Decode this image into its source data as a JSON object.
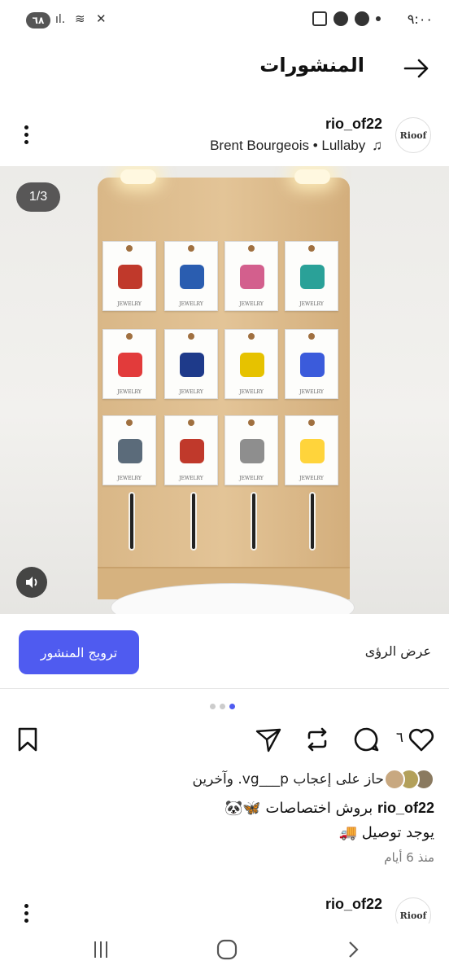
{
  "status_bar": {
    "battery": "٦٨",
    "time": "٩:٠٠"
  },
  "header": {
    "title": "المنشورات",
    "back_icon": "arrow-right-icon"
  },
  "post": {
    "avatar_text": "Rioof",
    "username": "rio_of22",
    "music": "Brent Bourgeois • Lullaby",
    "media": {
      "counter": "1/3",
      "card_label": "JEWELRY",
      "pin_colors": [
        "#c0392b",
        "#2a5db0",
        "#d35f8d",
        "#2aa198",
        "#e23b3b",
        "#1e3a8a",
        "#e6c200",
        "#3b5bdb",
        "#5b6b7a",
        "#c0392b",
        "#8e8e8e",
        "#ffd43b"
      ]
    },
    "promote_button": "ترويج المنشور",
    "view_insights": "عرض الرؤى",
    "carousel": {
      "total": 3,
      "active": 3
    },
    "like_count": "٦",
    "liked_by_text": "حاز على إعجاب vg___p. وآخرين",
    "caption_user": "rio_of22",
    "caption_text": " بروش اختصاصات 🦋🐼",
    "caption_line2": "يوجد توصيل 🚚",
    "time_ago": "منذ 6 أيام"
  },
  "next_post": {
    "avatar_text": "Rioof",
    "username": "rio_of22"
  },
  "colors": {
    "accent": "#4f5bf0"
  }
}
